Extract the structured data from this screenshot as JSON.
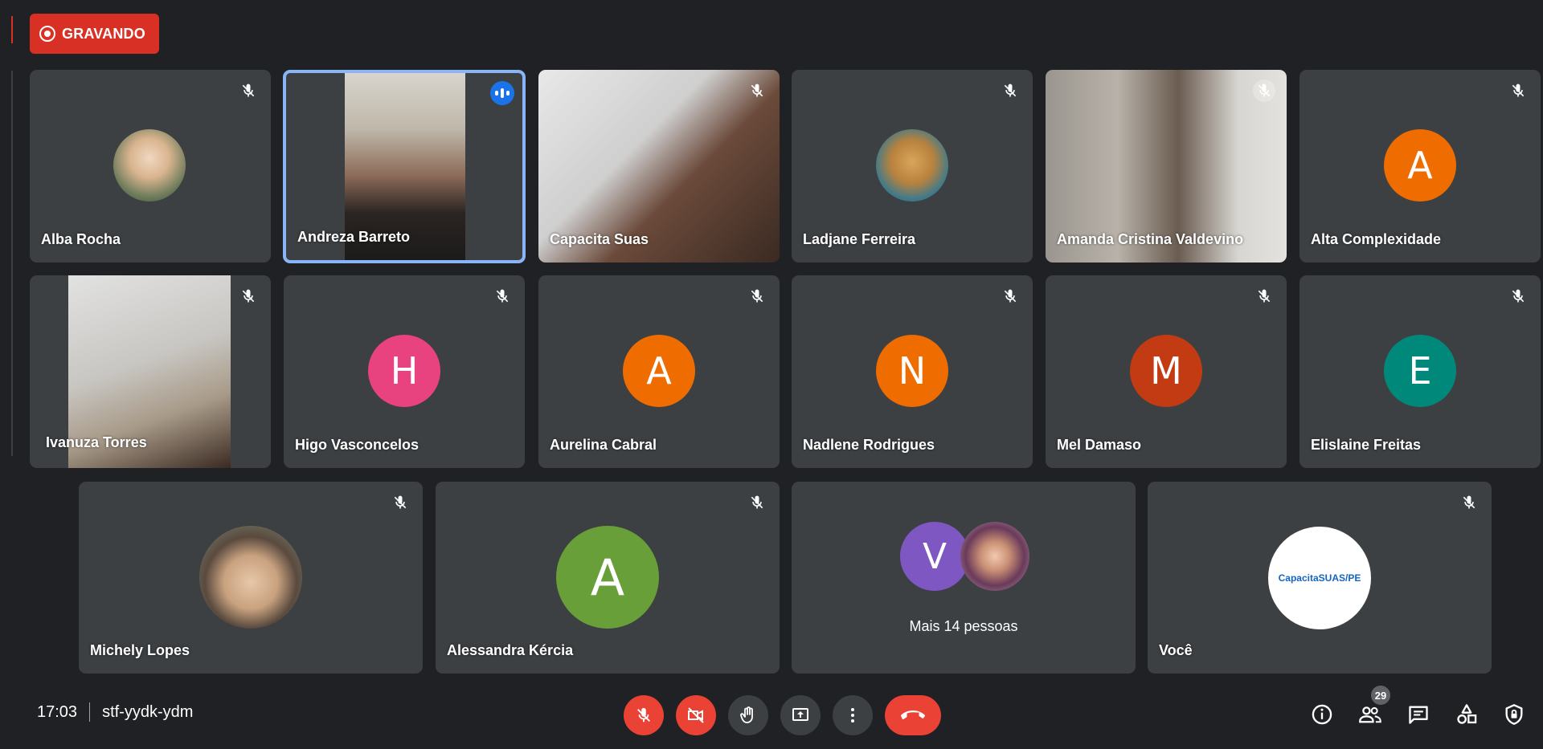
{
  "recording": {
    "label": "GRAVANDO"
  },
  "participants": [
    {
      "name": "Alba Rocha"
    },
    {
      "name": "Andreza Barreto"
    },
    {
      "name": "Capacita Suas"
    },
    {
      "name": "Ladjane Ferreira"
    },
    {
      "name": "Amanda Cristina Valdevino"
    },
    {
      "name": "Alta Complexidade",
      "initial": "A",
      "color": "#ef6c00"
    },
    {
      "name": "Ivanuza Torres"
    },
    {
      "name": "Higo Vasconcelos",
      "initial": "H",
      "color": "#e8437f"
    },
    {
      "name": "Aurelina Cabral",
      "initial": "A",
      "color": "#ef6c00"
    },
    {
      "name": "Nadlene Rodrigues",
      "initial": "N",
      "color": "#ef6c00"
    },
    {
      "name": "Mel Damaso",
      "initial": "M",
      "color": "#c23b13"
    },
    {
      "name": "Elislaine Freitas",
      "initial": "E",
      "color": "#00897b"
    },
    {
      "name": "Michely Lopes"
    },
    {
      "name": "Alessandra Kércia",
      "initial": "A",
      "color": "#689f38"
    },
    {
      "more": "Mais 14 pessoas",
      "initial": "V",
      "color": "#7e57c2"
    },
    {
      "name": "Você",
      "logo_text": "CapacitaSUAS/PE"
    }
  ],
  "footer": {
    "time": "17:03",
    "meeting_code": "stf-yydk-ydm",
    "people_count": "29"
  },
  "icons": [
    "mic-off-icon",
    "camera-off-icon",
    "raise-hand-icon",
    "present-screen-icon",
    "more-options-icon",
    "hang-up-icon",
    "info-icon",
    "people-icon",
    "chat-icon",
    "activities-icon",
    "host-controls-icon"
  ]
}
